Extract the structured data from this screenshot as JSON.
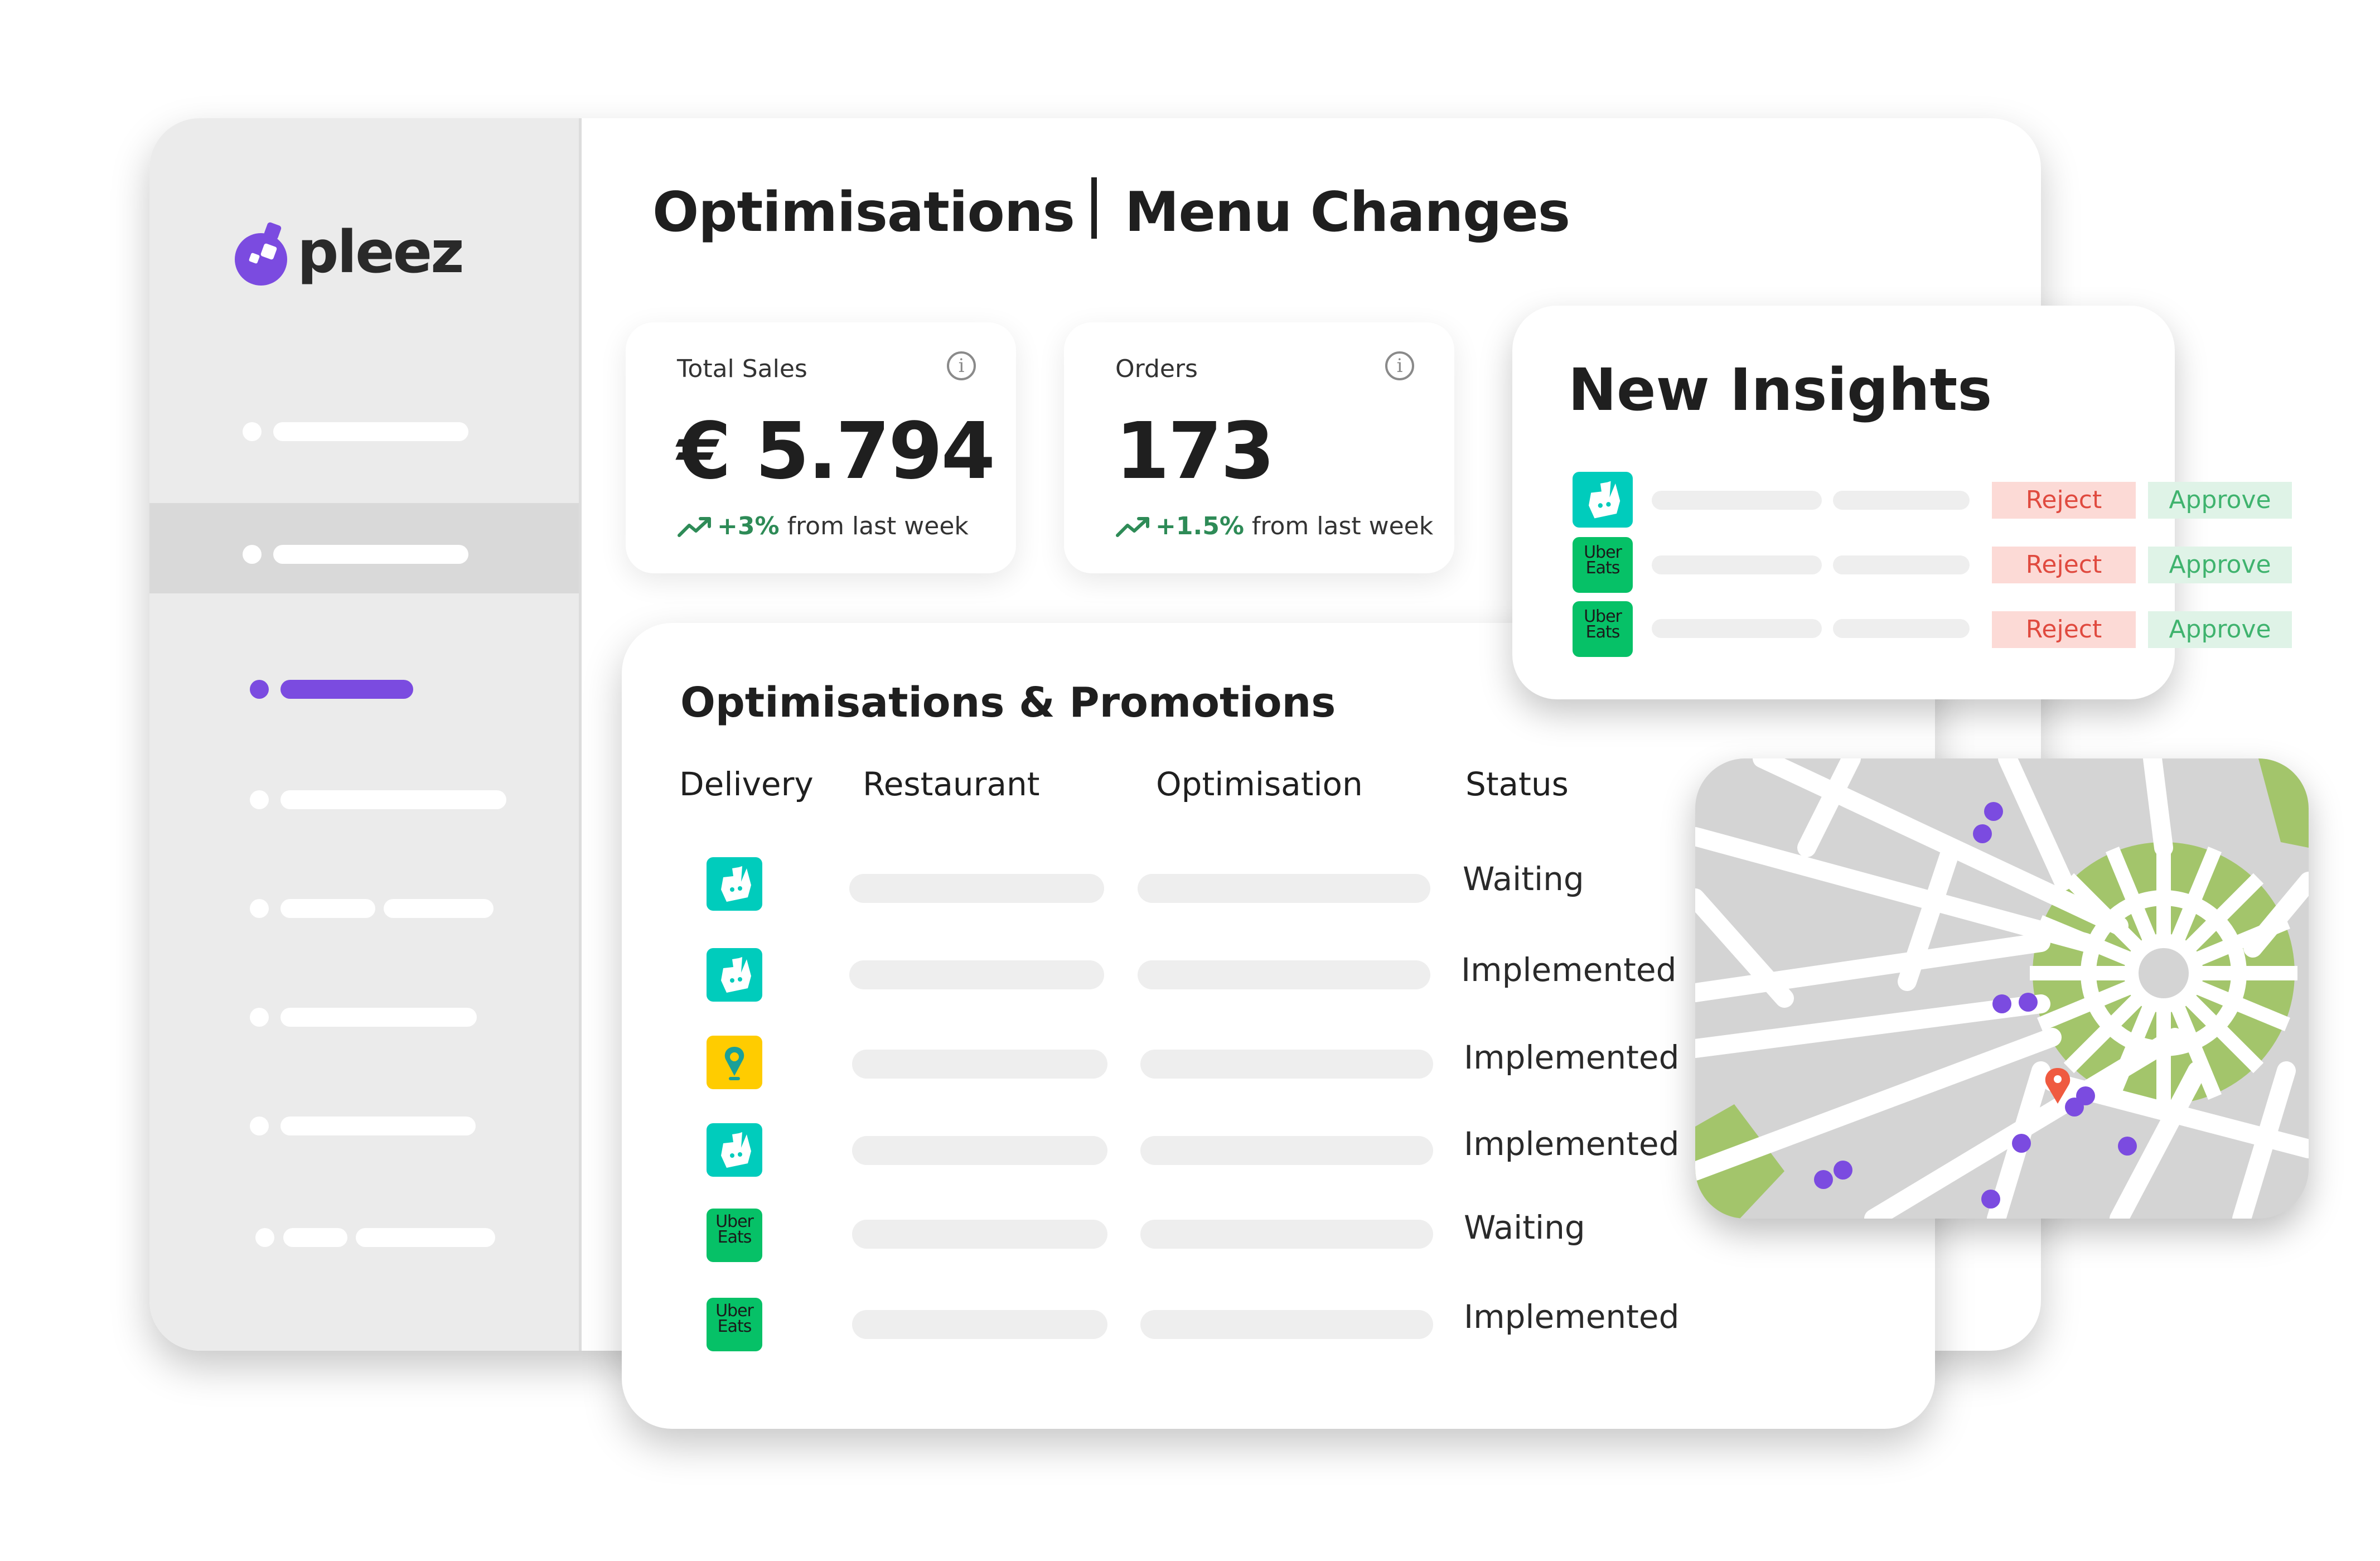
{
  "app": {
    "logo_text": "pleez",
    "title_left": "Optimisations",
    "title_right": "Menu Changes"
  },
  "colors": {
    "brand_purple": "#7b4be0",
    "deliveroo": "#00ccbc",
    "ubereats": "#06c167",
    "justeat": "#ffcc00",
    "positive": "#2e8b57",
    "reject": "#e04a3f",
    "approve": "#3fb36e",
    "park_green": "#a3c56b"
  },
  "kpis": [
    {
      "label": "Total Sales",
      "value": "€ 5.794",
      "change": "+3%",
      "suffix": " from last week",
      "icon": "info-icon"
    },
    {
      "label": "Orders",
      "value": "173",
      "change": "+1.5%",
      "suffix": " from last week",
      "icon": "info-icon"
    }
  ],
  "optimisations": {
    "title": "Optimisations & Promotions",
    "columns": [
      "Delivery",
      "Restaurant",
      "Optimisation",
      "Status"
    ],
    "rows": [
      {
        "platform": "deliveroo",
        "status": "Waiting"
      },
      {
        "platform": "deliveroo",
        "status": "Implemented"
      },
      {
        "platform": "justeat",
        "status": "Implemented"
      },
      {
        "platform": "deliveroo",
        "status": "Implemented"
      },
      {
        "platform": "ubereats",
        "status": "Waiting"
      },
      {
        "platform": "ubereats",
        "status": "Implemented"
      }
    ]
  },
  "uber_logo": {
    "line1": "Uber",
    "line2": "Eats"
  },
  "insights": {
    "title": "New Insights",
    "reject_label": "Reject",
    "approve_label": "Approve",
    "rows": [
      {
        "platform": "deliveroo"
      },
      {
        "platform": "ubereats"
      },
      {
        "platform": "ubereats"
      }
    ]
  },
  "map": {
    "icon": "location-pin-icon"
  }
}
